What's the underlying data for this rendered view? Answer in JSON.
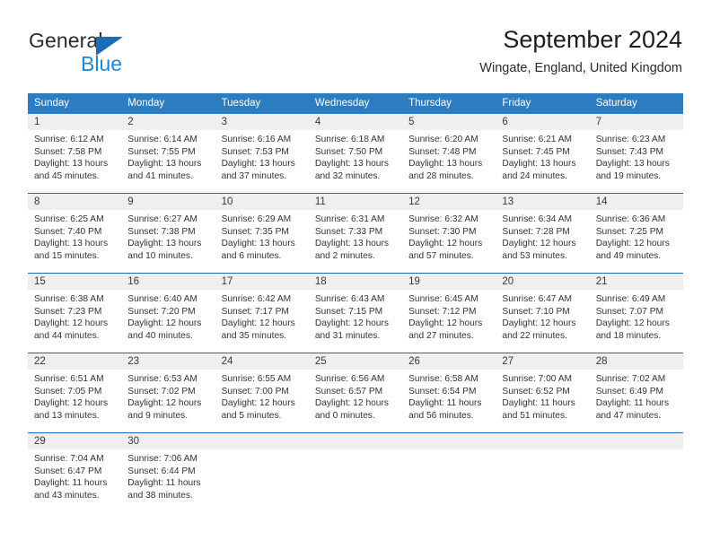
{
  "brand": {
    "name_part1": "General",
    "name_part2": "Blue",
    "triangle_color": "#1b6cb5",
    "blue_color": "#1b87d4"
  },
  "header": {
    "title": "September 2024",
    "subtitle": "Wingate, England, United Kingdom"
  },
  "theme": {
    "header_row_bg": "#2b7cc1",
    "row_divider": "#1b6cb5",
    "day_band_bg": "#efefef",
    "text_color": "#333333"
  },
  "weekdays": [
    "Sunday",
    "Monday",
    "Tuesday",
    "Wednesday",
    "Thursday",
    "Friday",
    "Saturday"
  ],
  "labels": {
    "sunrise_prefix": "Sunrise:",
    "sunset_prefix": "Sunset:",
    "daylight_prefix": "Daylight:"
  },
  "weeks": [
    [
      {
        "day": "1",
        "sunrise": "Sunrise: 6:12 AM",
        "sunset": "Sunset: 7:58 PM",
        "daylight": "Daylight: 13 hours and 45 minutes."
      },
      {
        "day": "2",
        "sunrise": "Sunrise: 6:14 AM",
        "sunset": "Sunset: 7:55 PM",
        "daylight": "Daylight: 13 hours and 41 minutes."
      },
      {
        "day": "3",
        "sunrise": "Sunrise: 6:16 AM",
        "sunset": "Sunset: 7:53 PM",
        "daylight": "Daylight: 13 hours and 37 minutes."
      },
      {
        "day": "4",
        "sunrise": "Sunrise: 6:18 AM",
        "sunset": "Sunset: 7:50 PM",
        "daylight": "Daylight: 13 hours and 32 minutes."
      },
      {
        "day": "5",
        "sunrise": "Sunrise: 6:20 AM",
        "sunset": "Sunset: 7:48 PM",
        "daylight": "Daylight: 13 hours and 28 minutes."
      },
      {
        "day": "6",
        "sunrise": "Sunrise: 6:21 AM",
        "sunset": "Sunset: 7:45 PM",
        "daylight": "Daylight: 13 hours and 24 minutes."
      },
      {
        "day": "7",
        "sunrise": "Sunrise: 6:23 AM",
        "sunset": "Sunset: 7:43 PM",
        "daylight": "Daylight: 13 hours and 19 minutes."
      }
    ],
    [
      {
        "day": "8",
        "sunrise": "Sunrise: 6:25 AM",
        "sunset": "Sunset: 7:40 PM",
        "daylight": "Daylight: 13 hours and 15 minutes."
      },
      {
        "day": "9",
        "sunrise": "Sunrise: 6:27 AM",
        "sunset": "Sunset: 7:38 PM",
        "daylight": "Daylight: 13 hours and 10 minutes."
      },
      {
        "day": "10",
        "sunrise": "Sunrise: 6:29 AM",
        "sunset": "Sunset: 7:35 PM",
        "daylight": "Daylight: 13 hours and 6 minutes."
      },
      {
        "day": "11",
        "sunrise": "Sunrise: 6:31 AM",
        "sunset": "Sunset: 7:33 PM",
        "daylight": "Daylight: 13 hours and 2 minutes."
      },
      {
        "day": "12",
        "sunrise": "Sunrise: 6:32 AM",
        "sunset": "Sunset: 7:30 PM",
        "daylight": "Daylight: 12 hours and 57 minutes."
      },
      {
        "day": "13",
        "sunrise": "Sunrise: 6:34 AM",
        "sunset": "Sunset: 7:28 PM",
        "daylight": "Daylight: 12 hours and 53 minutes."
      },
      {
        "day": "14",
        "sunrise": "Sunrise: 6:36 AM",
        "sunset": "Sunset: 7:25 PM",
        "daylight": "Daylight: 12 hours and 49 minutes."
      }
    ],
    [
      {
        "day": "15",
        "sunrise": "Sunrise: 6:38 AM",
        "sunset": "Sunset: 7:23 PM",
        "daylight": "Daylight: 12 hours and 44 minutes."
      },
      {
        "day": "16",
        "sunrise": "Sunrise: 6:40 AM",
        "sunset": "Sunset: 7:20 PM",
        "daylight": "Daylight: 12 hours and 40 minutes."
      },
      {
        "day": "17",
        "sunrise": "Sunrise: 6:42 AM",
        "sunset": "Sunset: 7:17 PM",
        "daylight": "Daylight: 12 hours and 35 minutes."
      },
      {
        "day": "18",
        "sunrise": "Sunrise: 6:43 AM",
        "sunset": "Sunset: 7:15 PM",
        "daylight": "Daylight: 12 hours and 31 minutes."
      },
      {
        "day": "19",
        "sunrise": "Sunrise: 6:45 AM",
        "sunset": "Sunset: 7:12 PM",
        "daylight": "Daylight: 12 hours and 27 minutes."
      },
      {
        "day": "20",
        "sunrise": "Sunrise: 6:47 AM",
        "sunset": "Sunset: 7:10 PM",
        "daylight": "Daylight: 12 hours and 22 minutes."
      },
      {
        "day": "21",
        "sunrise": "Sunrise: 6:49 AM",
        "sunset": "Sunset: 7:07 PM",
        "daylight": "Daylight: 12 hours and 18 minutes."
      }
    ],
    [
      {
        "day": "22",
        "sunrise": "Sunrise: 6:51 AM",
        "sunset": "Sunset: 7:05 PM",
        "daylight": "Daylight: 12 hours and 13 minutes."
      },
      {
        "day": "23",
        "sunrise": "Sunrise: 6:53 AM",
        "sunset": "Sunset: 7:02 PM",
        "daylight": "Daylight: 12 hours and 9 minutes."
      },
      {
        "day": "24",
        "sunrise": "Sunrise: 6:55 AM",
        "sunset": "Sunset: 7:00 PM",
        "daylight": "Daylight: 12 hours and 5 minutes."
      },
      {
        "day": "25",
        "sunrise": "Sunrise: 6:56 AM",
        "sunset": "Sunset: 6:57 PM",
        "daylight": "Daylight: 12 hours and 0 minutes."
      },
      {
        "day": "26",
        "sunrise": "Sunrise: 6:58 AM",
        "sunset": "Sunset: 6:54 PM",
        "daylight": "Daylight: 11 hours and 56 minutes."
      },
      {
        "day": "27",
        "sunrise": "Sunrise: 7:00 AM",
        "sunset": "Sunset: 6:52 PM",
        "daylight": "Daylight: 11 hours and 51 minutes."
      },
      {
        "day": "28",
        "sunrise": "Sunrise: 7:02 AM",
        "sunset": "Sunset: 6:49 PM",
        "daylight": "Daylight: 11 hours and 47 minutes."
      }
    ],
    [
      {
        "day": "29",
        "sunrise": "Sunrise: 7:04 AM",
        "sunset": "Sunset: 6:47 PM",
        "daylight": "Daylight: 11 hours and 43 minutes."
      },
      {
        "day": "30",
        "sunrise": "Sunrise: 7:06 AM",
        "sunset": "Sunset: 6:44 PM",
        "daylight": "Daylight: 11 hours and 38 minutes."
      },
      {
        "day": "",
        "sunrise": "",
        "sunset": "",
        "daylight": ""
      },
      {
        "day": "",
        "sunrise": "",
        "sunset": "",
        "daylight": ""
      },
      {
        "day": "",
        "sunrise": "",
        "sunset": "",
        "daylight": ""
      },
      {
        "day": "",
        "sunrise": "",
        "sunset": "",
        "daylight": ""
      },
      {
        "day": "",
        "sunrise": "",
        "sunset": "",
        "daylight": ""
      }
    ]
  ]
}
